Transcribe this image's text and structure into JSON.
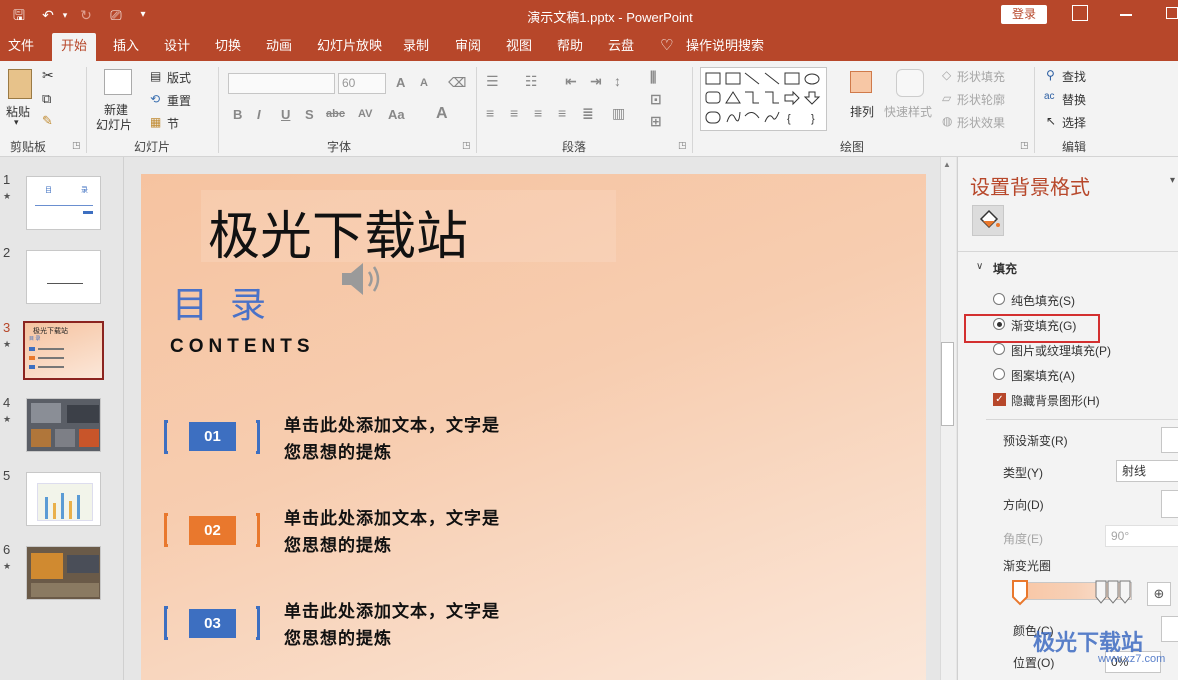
{
  "titlebar": {
    "doc_title": "演示文稿1.pptx  -  PowerPoint",
    "login": "登录",
    "quick_access": {
      "save": "🖫",
      "undo": "↶",
      "redo": "↻",
      "present": "⎚",
      "customize": "▾"
    }
  },
  "tabs": [
    "文件",
    "开始",
    "插入",
    "设计",
    "切换",
    "动画",
    "幻灯片放映",
    "录制",
    "审阅",
    "视图",
    "帮助",
    "云盘"
  ],
  "tell_me": "操作说明搜索",
  "ribbon": {
    "clipboard": {
      "paste": "粘贴",
      "label": "剪贴板"
    },
    "slides": {
      "new_slide_1": "新建",
      "new_slide_2": "幻灯片",
      "layout": "版式",
      "reset": "重置",
      "section": "节",
      "label": "幻灯片"
    },
    "font": {
      "font_size": "60",
      "label": "字体"
    },
    "paragraph": {
      "label": "段落"
    },
    "drawing": {
      "arrange": "排列",
      "quick_styles": "快速样式",
      "shape_fill": "形状填充",
      "shape_outline": "形状轮廓",
      "shape_effects": "形状效果",
      "label": "绘图"
    },
    "editing": {
      "find": "查找",
      "replace": "替换",
      "select": "选择",
      "label": "编辑"
    }
  },
  "thumbnails": [
    {
      "num": "1",
      "star": "★"
    },
    {
      "num": "2",
      "star": ""
    },
    {
      "num": "3",
      "star": "★"
    },
    {
      "num": "4",
      "star": "★"
    },
    {
      "num": "5",
      "star": ""
    },
    {
      "num": "6",
      "star": "★"
    }
  ],
  "thumb_text": {
    "t1_a": "目",
    "t1_b": "录",
    "t3_title": "极光下载站",
    "t3_sub": "目 录"
  },
  "slide": {
    "title": "极光下载站",
    "heading": "目 录",
    "subheading": "CONTENTS",
    "items": [
      {
        "num": "01",
        "line1": "单击此处添加文本，文字是",
        "line2": "您思想的提炼",
        "color": "#3d6fc1"
      },
      {
        "num": "02",
        "line1": "单击此处添加文本，文字是",
        "line2": "您思想的提炼",
        "color": "#e9782d"
      },
      {
        "num": "03",
        "line1": "单击此处添加文本，文字是",
        "line2": "您思想的提炼",
        "color": "#3d6fc1"
      }
    ]
  },
  "pane": {
    "title": "设置背景格式",
    "section": "填充",
    "options": [
      "纯色填充(S)",
      "渐变填充(G)",
      "图片或纹理填充(P)",
      "图案填充(A)"
    ],
    "selected_index": 1,
    "hide_bg": "隐藏背景图形(H)",
    "preset": "预设渐变(R)",
    "type_label": "类型(Y)",
    "type_value": "射线",
    "direction": "方向(D)",
    "angle_label": "角度(E)",
    "angle_value": "90°",
    "stops_label": "渐变光圈",
    "color_label": "颜色(C)",
    "position_label": "位置(O)",
    "position_value": "0%"
  },
  "watermark": {
    "text": "极光下载站",
    "url": "www.xz7.com"
  },
  "colors": {
    "accent": "#b7472a",
    "highlight_box": "#d32f2f",
    "badge_blue": "#3d6fc1",
    "badge_orange": "#e9782d"
  }
}
